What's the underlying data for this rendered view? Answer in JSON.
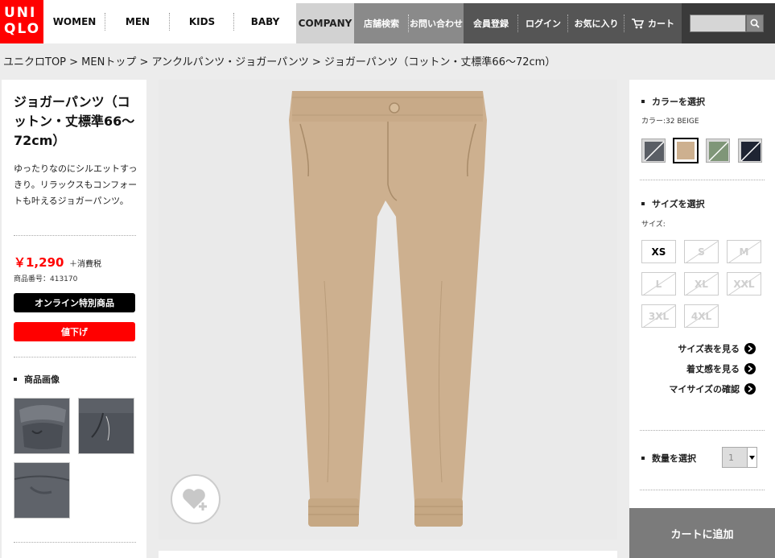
{
  "header": {
    "logo": [
      "UNI",
      "QLO"
    ],
    "nav_main": [
      "WOMEN",
      "MEN",
      "KIDS",
      "BABY"
    ],
    "company": "COMPANY",
    "nav_store": [
      "店舗検索",
      "お問い合わせ"
    ],
    "nav_account": [
      "会員登録",
      "ログイン",
      "お気に入り"
    ],
    "cart": "カート",
    "search_placeholder": ""
  },
  "breadcrumb": "ユニクロTOP > MENトップ > アンクルパンツ・ジョガーパンツ > ジョガーパンツ（コットン・丈標準66〜72cm）",
  "product": {
    "title": "ジョガーパンツ（コットン・丈標準66〜72cm）",
    "description": "ゆったりなのにシルエットすっきり。リラックスもコンフォートも叶えるジョガーパンツ。",
    "price": "￥1,290",
    "tax": "＋消費税",
    "product_number": "商品番号：413170",
    "tag_online": "オンライン特別商品",
    "tag_discount": "値下げ",
    "images_heading": "商品画像"
  },
  "color": {
    "heading": "カラーを選択",
    "label": "カラー:32 BEIGE",
    "swatches": [
      {
        "name": "gray",
        "hex": "#d8d8d8",
        "selected": false
      },
      {
        "name": "beige",
        "hex": "#cdb08f",
        "selected": true
      },
      {
        "name": "green",
        "hex": "#7f9678",
        "selected": false
      },
      {
        "name": "navy",
        "hex": "#1f2433",
        "selected": false
      }
    ]
  },
  "size": {
    "heading": "サイズを選択",
    "label": "サイズ:",
    "options": [
      "XS",
      "S",
      "M",
      "L",
      "XL",
      "XXL",
      "3XL",
      "4XL"
    ]
  },
  "links": [
    "サイズ表を見る",
    "着丈感を見る",
    "マイサイズの確認"
  ],
  "quantity": {
    "heading": "数量を選択",
    "value": "1"
  },
  "cart_button": "カートに追加",
  "colors": {
    "brand_red": "#ff0000",
    "dark": "#555555",
    "mid": "#8a8a8a"
  }
}
